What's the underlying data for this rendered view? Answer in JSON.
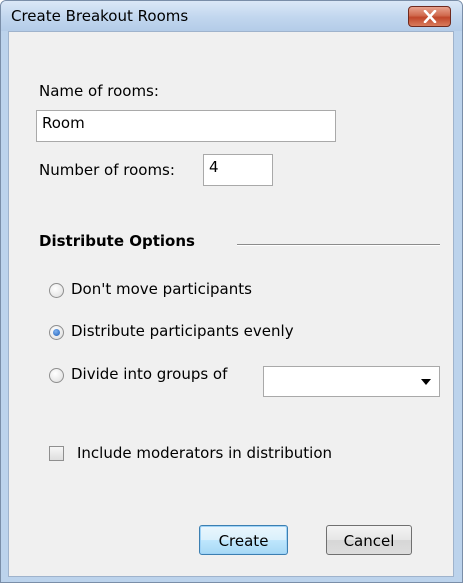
{
  "window": {
    "title": "Create Breakout Rooms"
  },
  "form": {
    "name_label": "Name of rooms:",
    "name_value": "Room",
    "number_label": "Number of rooms:",
    "number_value": "4"
  },
  "distribute": {
    "heading": "Distribute Options",
    "options": [
      {
        "label": "Don't move participants",
        "selected": false
      },
      {
        "label": "Distribute participants evenly",
        "selected": true
      },
      {
        "label": "Divide into groups of",
        "selected": false
      }
    ],
    "group_size_value": ""
  },
  "moderators": {
    "label": "Include moderators in distribution",
    "checked": false
  },
  "buttons": {
    "create": "Create",
    "cancel": "Cancel"
  },
  "colors": {
    "title_bar": "#c1d6ee",
    "close_button": "#c0462a",
    "dialog_background": "#f0f0f0",
    "radio_selected": "#1f5fb8"
  }
}
